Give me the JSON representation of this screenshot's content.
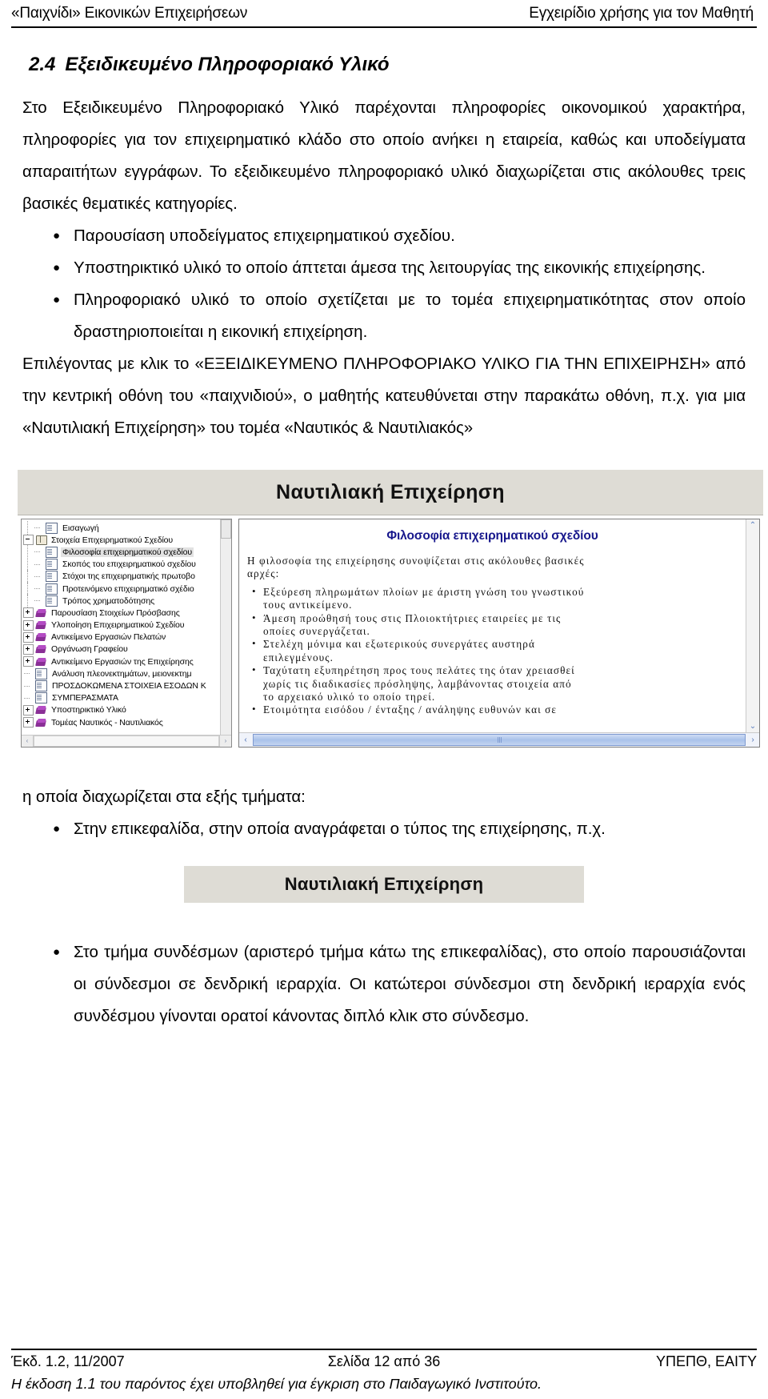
{
  "header": {
    "left": "«Παιχνίδι» Εικονικών Επιχειρήσεων",
    "right": "Εγχειρίδιο χρήσης για τον Μαθητή"
  },
  "section": {
    "number": "2.4",
    "title": "Εξειδικευμένο Πληροφοριακό Υλικό"
  },
  "paragraphs": {
    "intro": "Στο Εξειδικευμένο Πληροφοριακό Υλικό παρέχονται πληροφορίες οικονομικού χαρακτήρα, πληροφορίες για τον επιχειρηματικό κλάδο στο οποίο ανήκει η εταιρεία, καθώς και υποδείγματα απαραιτήτων εγγράφων. Το εξειδικευμένο πληροφοριακό υλικό διαχωρίζεται στις ακόλουθες τρεις βασικές θεματικές κατηγορίες.",
    "after_list": "Επιλέγοντας με κλικ το «ΕΞΕΙΔΙΚΕΥΜΕΝΟ ΠΛΗΡΟΦΟΡΙΑΚΟ ΥΛΙΚΟ ΓΙΑ ΤΗΝ ΕΠΙΧΕΙΡΗΣΗ» από την κεντρική οθόνη του «παιχνιδιού», ο μαθητής κατευθύνεται στην παρακάτω οθόνη, π.χ. για μια «Ναυτιλιακή Επιχείρηση» του τομέα «Ναυτικός & Ναυτιλιακός»",
    "after_shot": "η οποία διαχωρίζεται στα εξής τμήματα:"
  },
  "bullet_list_1": [
    "Παρουσίαση υποδείγματος επιχειρηματικού σχεδίου.",
    "Υποστηρικτικό υλικό το οποίο άπτεται άμεσα της λειτουργίας της εικονικής επιχείρησης.",
    "Πληροφοριακό υλικό το οποίο σχετίζεται με το τομέα επιχειρηματικότητας στον οποίο δραστηριοποιείται η εικονική επιχείρηση."
  ],
  "bullet_list_2": [
    "Στην επικεφαλίδα, στην οποία αναγράφεται ο τύπος της επιχείρησης, π.χ."
  ],
  "bullet_list_3": [
    "Στο τμήμα συνδέσμων (αριστερό τμήμα κάτω της επικεφαλίδας), στο οποίο παρουσιάζονται οι σύνδεσμοι σε δενδρική ιεραρχία. Οι κατώτεροι σύνδεσμοι στη δενδρική ιεραρχία ενός συνδέσμου γίνονται ορατοί κάνοντας διπλό κλικ στο σύνδεσμο."
  ],
  "screenshot": {
    "banner_title": "Ναυτιλιακή Επιχείρηση",
    "tree": [
      {
        "label": "Εισαγωγή",
        "icon": "document-icon",
        "expander": "none",
        "depth": 1,
        "selected": false
      },
      {
        "label": "Στοιχεία Επιχειρηματικού Σχεδίου",
        "icon": "open-book-icon",
        "expander": "minus",
        "depth": 0,
        "selected": false
      },
      {
        "label": "Φιλοσοφία επιχειρηματικού σχεδίου",
        "icon": "document-icon",
        "expander": "none",
        "depth": 2,
        "selected": true
      },
      {
        "label": "Σκοπός του επιχειρηματικού σχεδίου",
        "icon": "document-icon",
        "expander": "none",
        "depth": 2,
        "selected": false
      },
      {
        "label": "Στόχοι της επιχειρηματικής πρωτοβο",
        "icon": "document-icon",
        "expander": "none",
        "depth": 2,
        "selected": false
      },
      {
        "label": "Προτεινόμενο επιχειρηματικό σχέδιο",
        "icon": "document-icon",
        "expander": "none",
        "depth": 2,
        "selected": false
      },
      {
        "label": "Τρόπος χρηματοδότησης",
        "icon": "document-icon",
        "expander": "none",
        "depth": 2,
        "selected": false
      },
      {
        "label": "Παρουσίαση Στοιχείων Πρόσβασης",
        "icon": "book-icon",
        "expander": "plus",
        "depth": 0,
        "selected": false
      },
      {
        "label": "Υλοποίηση Επιχειρηματικού Σχεδίου",
        "icon": "book-icon",
        "expander": "plus",
        "depth": 0,
        "selected": false
      },
      {
        "label": "Αντικείμενο Εργασιών Πελατών",
        "icon": "book-icon",
        "expander": "plus",
        "depth": 0,
        "selected": false
      },
      {
        "label": "Οργάνωση Γραφείου",
        "icon": "book-icon",
        "expander": "plus",
        "depth": 0,
        "selected": false
      },
      {
        "label": "Αντικείμενο Εργασιών της Επιχείρησης",
        "icon": "book-icon",
        "expander": "plus",
        "depth": 0,
        "selected": false
      },
      {
        "label": "Ανάλυση πλεονεκτημάτων, μειονεκτημ",
        "icon": "document-icon",
        "expander": "none",
        "depth": 1,
        "selected": false
      },
      {
        "label": "ΠΡΟΣΔΟΚΩΜΕΝΑ ΣΤΟΙΧΕΙΑ ΕΣΟΔΩΝ Κ",
        "icon": "document-icon",
        "expander": "none",
        "depth": 1,
        "selected": false
      },
      {
        "label": "ΣΥΜΠΕΡΑΣΜΑΤΑ",
        "icon": "document-icon",
        "expander": "none",
        "depth": 1,
        "selected": false
      },
      {
        "label": "Υποστηρικτικό Υλικό",
        "icon": "book-icon",
        "expander": "plus",
        "depth": 0,
        "selected": false
      },
      {
        "label": "Τομέας Ναυτικός - Ναυτιλιακός",
        "icon": "book-icon",
        "expander": "plus",
        "depth": 0,
        "selected": false
      }
    ],
    "doc": {
      "title": "Φιλοσοφία επιχειρηματικού σχεδίου",
      "intro_lines": [
        "Η φιλοσοφία της επιχείρησης συνοψίζεται στις ακόλουθες βασικές",
        "αρχές:"
      ],
      "bullets": [
        [
          "Εξεύρεση πληρωμάτων πλοίων με άριστη γνώση του γνωστικού",
          "τους αντικείμενο."
        ],
        [
          "Άμεση προώθησή τους στις Πλοιοκτήτριες εταιρείες με τις",
          "οποίες συνεργάζεται."
        ],
        [
          "Στελέχη μόνιμα και εξωτερικούς συνεργάτες αυστηρά",
          "επιλεγμένους."
        ],
        [
          "Ταχύτατη εξυπηρέτηση προς τους πελάτες της όταν χρειασθεί",
          "χωρίς τις διαδικασίες πρόσληψης, λαμβάνοντας στοιχεία από",
          "το αρχειακό υλικό το οποίο τηρεί."
        ],
        [
          "Ετοιμότητα εισόδου / ένταξης / ανάληψης ευθυνών και σε"
        ]
      ]
    },
    "scroll": {
      "up_arrow": "⌃",
      "down_arrow": "⌄",
      "left_arrow": "‹",
      "right_arrow": "›"
    }
  },
  "banner_image": {
    "title": "Ναυτιλιακή Επιχείρηση"
  },
  "footer": {
    "left": "Έκδ. 1.2, 11/2007",
    "center": "Σελίδα 12 από 36",
    "right": "ΥΠΕΠΘ, ΕΑΙΤΥ",
    "note": "Η έκδοση 1.1 του παρόντος έχει υποβληθεί για έγκριση στο Παιδαγωγικό Ινστιτούτο."
  },
  "colors": {
    "doc_title": "#17178c",
    "banner_bg": "#dedcd5",
    "book_icon": "#8a2f96"
  }
}
